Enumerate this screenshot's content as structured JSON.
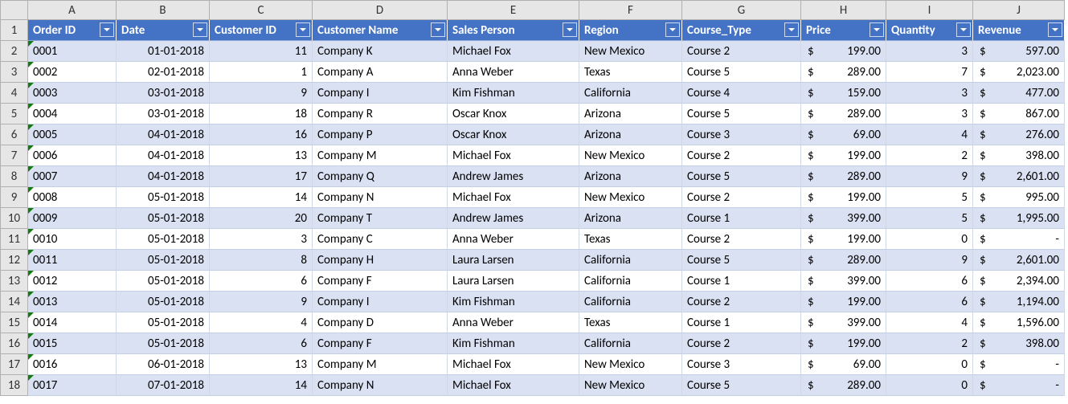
{
  "columns": [
    "A",
    "B",
    "C",
    "D",
    "E",
    "F",
    "G",
    "H",
    "I",
    "J"
  ],
  "headers": [
    "Order ID",
    "Date",
    "Customer ID",
    "Customer Name",
    "Sales Person",
    "Region",
    "Course_Type",
    "Price",
    "Quantity",
    "Revenue"
  ],
  "rows": [
    {
      "n": 2,
      "order_id": "0001",
      "date": "01-01-2018",
      "customer_id": 11,
      "customer_name": "Company K",
      "sales_person": "Michael Fox",
      "region": "New Mexico",
      "course_type": "Course 2",
      "price": "199.00",
      "quantity": 3,
      "revenue": "597.00"
    },
    {
      "n": 3,
      "order_id": "0002",
      "date": "02-01-2018",
      "customer_id": 1,
      "customer_name": "Company A",
      "sales_person": "Anna Weber",
      "region": "Texas",
      "course_type": "Course 5",
      "price": "289.00",
      "quantity": 7,
      "revenue": "2,023.00"
    },
    {
      "n": 4,
      "order_id": "0003",
      "date": "03-01-2018",
      "customer_id": 9,
      "customer_name": "Company I",
      "sales_person": "Kim Fishman",
      "region": "California",
      "course_type": "Course 4",
      "price": "159.00",
      "quantity": 3,
      "revenue": "477.00"
    },
    {
      "n": 5,
      "order_id": "0004",
      "date": "03-01-2018",
      "customer_id": 18,
      "customer_name": "Company R",
      "sales_person": "Oscar Knox",
      "region": "Arizona",
      "course_type": "Course 5",
      "price": "289.00",
      "quantity": 3,
      "revenue": "867.00"
    },
    {
      "n": 6,
      "order_id": "0005",
      "date": "04-01-2018",
      "customer_id": 16,
      "customer_name": "Company P",
      "sales_person": "Oscar Knox",
      "region": "Arizona",
      "course_type": "Course 3",
      "price": "69.00",
      "quantity": 4,
      "revenue": "276.00"
    },
    {
      "n": 7,
      "order_id": "0006",
      "date": "04-01-2018",
      "customer_id": 13,
      "customer_name": "Company M",
      "sales_person": "Michael Fox",
      "region": "New Mexico",
      "course_type": "Course 2",
      "price": "199.00",
      "quantity": 2,
      "revenue": "398.00"
    },
    {
      "n": 8,
      "order_id": "0007",
      "date": "04-01-2018",
      "customer_id": 17,
      "customer_name": "Company Q",
      "sales_person": "Andrew James",
      "region": "Arizona",
      "course_type": "Course 5",
      "price": "289.00",
      "quantity": 9,
      "revenue": "2,601.00"
    },
    {
      "n": 9,
      "order_id": "0008",
      "date": "05-01-2018",
      "customer_id": 14,
      "customer_name": "Company N",
      "sales_person": "Michael Fox",
      "region": "New Mexico",
      "course_type": "Course 2",
      "price": "199.00",
      "quantity": 5,
      "revenue": "995.00"
    },
    {
      "n": 10,
      "order_id": "0009",
      "date": "05-01-2018",
      "customer_id": 20,
      "customer_name": "Company T",
      "sales_person": "Andrew James",
      "region": "Arizona",
      "course_type": "Course 1",
      "price": "399.00",
      "quantity": 5,
      "revenue": "1,995.00"
    },
    {
      "n": 11,
      "order_id": "0010",
      "date": "05-01-2018",
      "customer_id": 3,
      "customer_name": "Company C",
      "sales_person": "Anna Weber",
      "region": "Texas",
      "course_type": "Course 2",
      "price": "199.00",
      "quantity": 0,
      "revenue": "-"
    },
    {
      "n": 12,
      "order_id": "0011",
      "date": "05-01-2018",
      "customer_id": 8,
      "customer_name": "Company H",
      "sales_person": "Laura Larsen",
      "region": "California",
      "course_type": "Course 5",
      "price": "289.00",
      "quantity": 9,
      "revenue": "2,601.00"
    },
    {
      "n": 13,
      "order_id": "0012",
      "date": "05-01-2018",
      "customer_id": 6,
      "customer_name": "Company F",
      "sales_person": "Laura Larsen",
      "region": "California",
      "course_type": "Course 1",
      "price": "399.00",
      "quantity": 6,
      "revenue": "2,394.00"
    },
    {
      "n": 14,
      "order_id": "0013",
      "date": "05-01-2018",
      "customer_id": 9,
      "customer_name": "Company I",
      "sales_person": "Kim Fishman",
      "region": "California",
      "course_type": "Course 2",
      "price": "199.00",
      "quantity": 6,
      "revenue": "1,194.00"
    },
    {
      "n": 15,
      "order_id": "0014",
      "date": "05-01-2018",
      "customer_id": 4,
      "customer_name": "Company D",
      "sales_person": "Anna Weber",
      "region": "Texas",
      "course_type": "Course 1",
      "price": "399.00",
      "quantity": 4,
      "revenue": "1,596.00"
    },
    {
      "n": 16,
      "order_id": "0015",
      "date": "05-01-2018",
      "customer_id": 6,
      "customer_name": "Company F",
      "sales_person": "Kim Fishman",
      "region": "California",
      "course_type": "Course 2",
      "price": "199.00",
      "quantity": 2,
      "revenue": "398.00"
    },
    {
      "n": 17,
      "order_id": "0016",
      "date": "06-01-2018",
      "customer_id": 13,
      "customer_name": "Company M",
      "sales_person": "Michael Fox",
      "region": "New Mexico",
      "course_type": "Course 3",
      "price": "69.00",
      "quantity": 0,
      "revenue": "-"
    },
    {
      "n": 18,
      "order_id": "0017",
      "date": "07-01-2018",
      "customer_id": 14,
      "customer_name": "Company N",
      "sales_person": "Michael Fox",
      "region": "New Mexico",
      "course_type": "Course 5",
      "price": "289.00",
      "quantity": 0,
      "revenue": "-"
    }
  ],
  "currency_symbol": "$"
}
